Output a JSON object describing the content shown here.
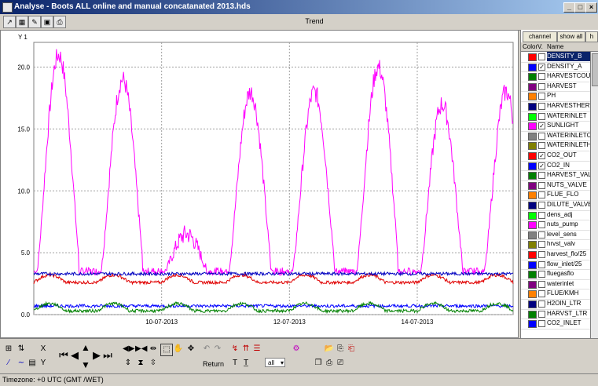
{
  "window": {
    "title": "Analyse - Boots ALL online and manual concatanated 2013.hds"
  },
  "header": {
    "trend_label": "Trend"
  },
  "plot": {
    "y_axis_label": "Y 1",
    "chart_data": {
      "type": "line",
      "ylim": [
        0,
        22
      ],
      "y_ticks": [
        "20.0",
        "15.0",
        "10.0",
        "5.0",
        "0.0"
      ],
      "y_tick_values": [
        20,
        15,
        10,
        5,
        0
      ],
      "x_ticks": [
        "10-07-2013",
        "12-07-2013",
        "14-07-2013"
      ],
      "x_tick_days": [
        2,
        4,
        6
      ],
      "x_range_days": [
        0,
        7.5
      ],
      "grid": true,
      "series": [
        {
          "name": "SUNLIGHT",
          "color": "#ff00ff",
          "peaks": [
            21,
            19,
            6.5,
            18,
            18,
            20,
            17,
            18
          ],
          "base": 3.5
        },
        {
          "name": "CO2_OUT",
          "color": "#e00000",
          "level": 2.6,
          "hump": 3.2
        },
        {
          "name": "CO2_IN",
          "color": "#0000c0",
          "level": 3.3
        },
        {
          "name": "DENSITY_A",
          "color": "#0000ff",
          "level": 0.7
        },
        {
          "name": "HARVEST_VALVE",
          "color": "#008000",
          "level": 0.3,
          "hump": 0.9
        }
      ]
    }
  },
  "channel_panel": {
    "tabs": [
      "channel filter",
      "show all",
      "h"
    ],
    "headers": {
      "color": "Color",
      "v": "V.",
      "name": "Name"
    },
    "channels": [
      {
        "name": "DENSITY_B",
        "color": "#ff0000",
        "checked": false,
        "selected": true
      },
      {
        "name": "DENSITY_A",
        "color": "#0000ff",
        "checked": true
      },
      {
        "name": "HARVESTCOUNTS",
        "color": "#008000",
        "checked": false
      },
      {
        "name": "HARVEST",
        "color": "#800080",
        "checked": false
      },
      {
        "name": "PH",
        "color": "#ff8000",
        "checked": false
      },
      {
        "name": "HARVESTHERTZ",
        "color": "#000080",
        "checked": false
      },
      {
        "name": "WATERINLET",
        "color": "#00ff00",
        "checked": false
      },
      {
        "name": "SUNLIGHT",
        "color": "#ff00ff",
        "checked": true
      },
      {
        "name": "WATERINLETCOL",
        "color": "#808080",
        "checked": false
      },
      {
        "name": "WATERINLETHEF",
        "color": "#808000",
        "checked": false
      },
      {
        "name": "CO2_OUT",
        "color": "#ff0000",
        "checked": true
      },
      {
        "name": "CO2_IN",
        "color": "#0000ff",
        "checked": true
      },
      {
        "name": "HARVEST_VALVE",
        "color": "#008000",
        "checked": false
      },
      {
        "name": "NUTS_VALVE",
        "color": "#800080",
        "checked": false
      },
      {
        "name": "FLUE_FLO",
        "color": "#ff8000",
        "checked": false
      },
      {
        "name": "DILUTE_VALVE",
        "color": "#000080",
        "checked": false
      },
      {
        "name": "dens_adj",
        "color": "#00ff00",
        "checked": false
      },
      {
        "name": "nuts_pump",
        "color": "#ff00ff",
        "checked": false
      },
      {
        "name": "level_sens",
        "color": "#808080",
        "checked": false
      },
      {
        "name": "hrvst_valv",
        "color": "#808000",
        "checked": false
      },
      {
        "name": "harvest_flo/25",
        "color": "#ff0000",
        "checked": false
      },
      {
        "name": "flow_inlet/25",
        "color": "#0000ff",
        "checked": false
      },
      {
        "name": "fluegasflo",
        "color": "#008000",
        "checked": false
      },
      {
        "name": "waterinlet",
        "color": "#800080",
        "checked": false
      },
      {
        "name": "FLUE/KMH",
        "color": "#ff8000",
        "checked": false
      },
      {
        "name": "H2OIN_LTR",
        "color": "#000080",
        "checked": false
      },
      {
        "name": "HARVST_LTR",
        "color": "#008000",
        "checked": false
      },
      {
        "name": "CO2_INLET",
        "color": "#0000ff",
        "checked": false
      }
    ]
  },
  "bottom_toolbar": {
    "return_label": "Return",
    "range_select": "all"
  },
  "status": {
    "timezone": "Timezone: +0 UTC (GMT /WET)"
  }
}
